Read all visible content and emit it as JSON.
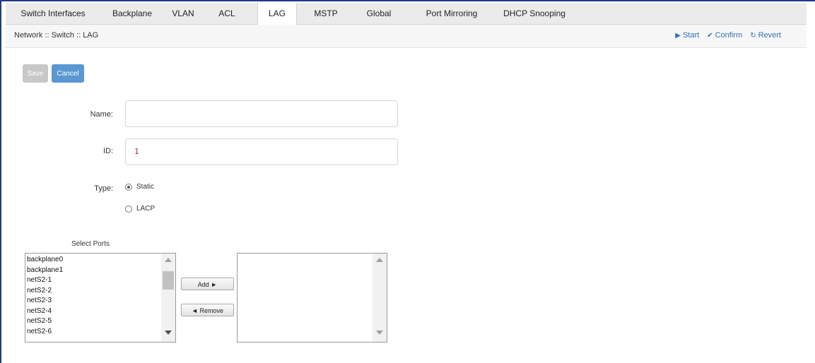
{
  "tabs": [
    "Switch Interfaces",
    "Backplane",
    "VLAN",
    "ACL",
    "LAG",
    "MSTP",
    "Global",
    "Port Mirroring",
    "DHCP Snooping"
  ],
  "active_tab": "LAG",
  "breadcrumb": "Network :: Switch :: LAG",
  "actions": {
    "start": {
      "label": "Start",
      "icon": "play-icon"
    },
    "confirm": {
      "label": "Confirm",
      "icon": "check-icon"
    },
    "revert": {
      "label": "Revert",
      "icon": "undo-icon"
    }
  },
  "buttons": {
    "save": "Save",
    "cancel": "Cancel"
  },
  "form": {
    "name": {
      "label": "Name:",
      "value": ""
    },
    "id": {
      "label": "ID:",
      "value": "1"
    },
    "type": {
      "label": "Type:",
      "options": [
        "Static",
        "LACP"
      ],
      "selected": "Static"
    }
  },
  "ports": {
    "heading": "Select Ports",
    "available": [
      "backplane0",
      "backplane1",
      "netS2-1",
      "netS2-2",
      "netS2-3",
      "netS2-4",
      "netS2-5",
      "netS2-6"
    ],
    "selected": [],
    "add_label": "Add ►",
    "remove_label": "◄ Remove"
  },
  "colors": {
    "accent": "#5b97d3",
    "border": "#1f3a8a",
    "link": "#2e6fb7"
  }
}
